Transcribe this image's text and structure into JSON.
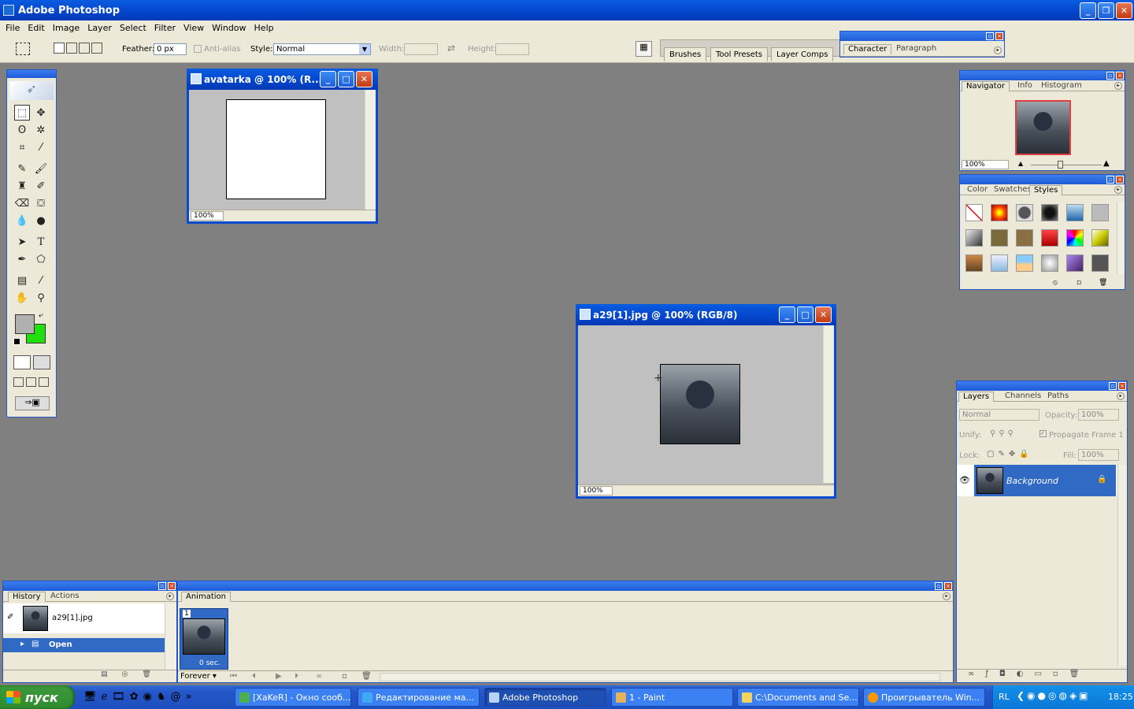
{
  "app": {
    "title": "Adobe Photoshop"
  },
  "menu": [
    "File",
    "Edit",
    "Image",
    "Layer",
    "Select",
    "Filter",
    "View",
    "Window",
    "Help"
  ],
  "options": {
    "feather_label": "Feather:",
    "feather_value": "0 px",
    "antialias_label": "Anti-alias",
    "style_label": "Style:",
    "style_value": "Normal",
    "width_label": "Width:",
    "height_label": "Height:"
  },
  "well_tabs": [
    "Brushes",
    "Tool Presets",
    "Layer Comps"
  ],
  "character_palette": {
    "tabs": [
      "Character",
      "Paragraph"
    ]
  },
  "doc1": {
    "title": "avatarka @ 100% (R...",
    "zoom": "100%"
  },
  "doc2": {
    "title": "a29[1].jpg @ 100% (RGB/8)",
    "zoom": "100%"
  },
  "navigator": {
    "tabs": [
      "Navigator",
      "Info",
      "Histogram"
    ],
    "zoom": "100%"
  },
  "styles_palette": {
    "tabs": [
      "Color",
      "Swatches",
      "Styles"
    ]
  },
  "layers": {
    "tabs": [
      "Layers",
      "Channels",
      "Paths"
    ],
    "blend_mode": "Normal",
    "opacity_label": "Opacity:",
    "opacity_value": "100%",
    "unify_label": "Unify:",
    "propagate_label": "Propagate Frame 1",
    "lock_label": "Lock:",
    "fill_label": "Fill:",
    "fill_value": "100%",
    "layer_name": "Background"
  },
  "history": {
    "tabs": [
      "History",
      "Actions"
    ],
    "snapshot": "a29[1].jpg",
    "step": "Open"
  },
  "animation": {
    "tab": "Animation",
    "frame_number": "1",
    "frame_delay": "0 sec.",
    "loop": "Forever"
  },
  "taskbar": {
    "start": "пуск",
    "tasks": [
      "[XaKeR] - Окно сооб...",
      "Редактирование ма...",
      "Adobe Photoshop",
      "1 - Paint",
      "C:\\Documents and Se...",
      "Проигрыватель Win..."
    ],
    "lang": "RL",
    "clock": "18:25"
  },
  "colors": {
    "foreground": "#b0b0b0",
    "background": "#22e010"
  }
}
